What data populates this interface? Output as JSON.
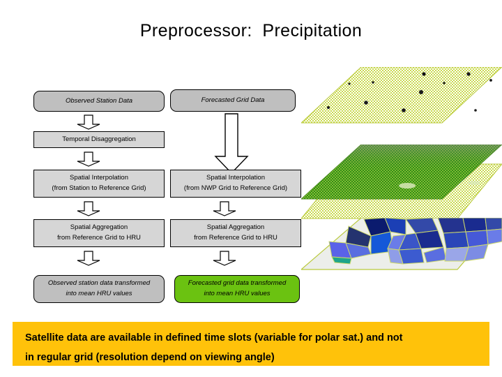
{
  "slide": {
    "title": "Preprocessor:  Precipitation"
  },
  "flow": {
    "left_column": {
      "start": {
        "label": "Observed Station Data"
      },
      "step1": {
        "label": "Temporal Disaggregation"
      },
      "step2": {
        "line1": "Spatial Interpolation",
        "line2": "(from Station to Reference Grid)"
      },
      "step3": {
        "line1": "Spatial Aggregation",
        "line2": "from Reference Grid to HRU"
      },
      "end": {
        "line1": "Observed station data transformed",
        "line2": "into mean HRU values"
      }
    },
    "right_column": {
      "start": {
        "label": "Forecasted Grid Data"
      },
      "step2": {
        "line1": "Spatial Interpolation",
        "line2": "(from NWP Grid to Reference Grid)"
      },
      "step3": {
        "line1": "Spatial Aggregation",
        "line2": "from Reference Grid to HRU"
      },
      "end": {
        "line1": "Forecasted grid data transformed",
        "line2": "into mean HRU values"
      }
    },
    "arrows": {
      "left_a": "down-arrow-icon",
      "left_b": "down-arrow-icon",
      "left_c": "down-arrow-icon",
      "left_d": "down-arrow-icon",
      "right_big": "large-down-arrow-icon",
      "right_b": "down-arrow-icon",
      "right_c": "down-arrow-icon"
    }
  },
  "graphics": {
    "station_plane": {
      "name": "station-points-plane",
      "caption": ""
    },
    "grid_planes": {
      "name": "reference-grid-planes",
      "caption": ""
    },
    "hru_map": {
      "name": "hru-polygon-map",
      "caption": ""
    }
  },
  "banner": {
    "line1": "Satellite data are available in defined time slots (variable for polar sat.) and not",
    "line2": "in regular grid (resolution depend on viewing angle)"
  },
  "colors": {
    "banner_background": "#ffc20a",
    "box_gray": "#bfbfbf",
    "process_gray": "#d6d6d6",
    "accent_green": "#6bc211",
    "plane_yellow_green": "#c8d94a",
    "plane_green": "#4ba520"
  }
}
